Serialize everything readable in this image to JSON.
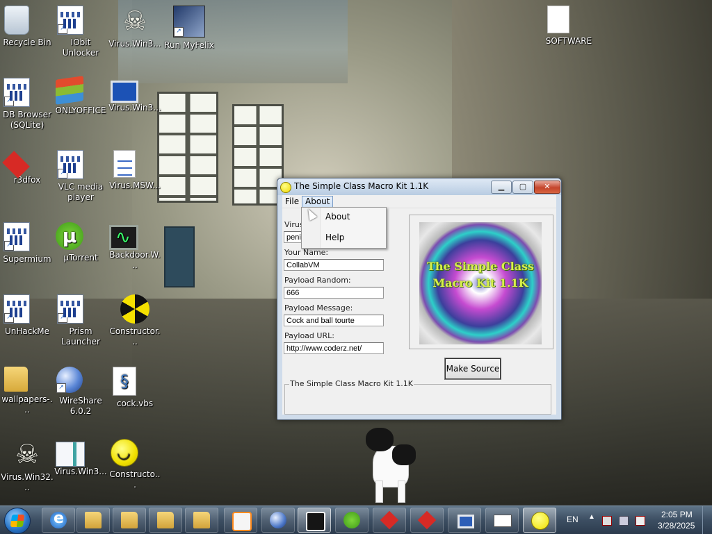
{
  "desktop": {
    "icons": [
      {
        "label": "Recycle Bin",
        "icon": "recycle-bin-icon"
      },
      {
        "label": "IObit Unlocker",
        "icon": "app-icon"
      },
      {
        "label": "Virus.Win3...",
        "icon": "skull-icon"
      },
      {
        "label": "Run MyFelix",
        "icon": "felix-icon"
      },
      {
        "label": "SOFTWARE",
        "icon": "file-icon"
      },
      {
        "label": "DB Browser (SQLite)",
        "icon": "app-icon"
      },
      {
        "label": "ONLYOFFICE",
        "icon": "onlyoffice-icon"
      },
      {
        "label": "Virus.Win3...",
        "icon": "computer-icon"
      },
      {
        "label": "r3dfox",
        "icon": "r3dfox-icon"
      },
      {
        "label": "VLC media player",
        "icon": "app-icon"
      },
      {
        "label": "Virus.MSW...",
        "icon": "document-icon"
      },
      {
        "label": "Supermium",
        "icon": "app-icon"
      },
      {
        "label": "µTorrent",
        "icon": "utorrent-icon"
      },
      {
        "label": "Backdoor.W...",
        "icon": "oscilloscope-icon"
      },
      {
        "label": "UnHackMe",
        "icon": "app-icon"
      },
      {
        "label": "Prism Launcher",
        "icon": "app-icon"
      },
      {
        "label": "Constructor...",
        "icon": "radiation-icon"
      },
      {
        "label": "wallpapers-...",
        "icon": "folder-icon"
      },
      {
        "label": "WireShare 6.0.2",
        "icon": "globe-icon"
      },
      {
        "label": "cock.vbs",
        "icon": "script-icon"
      },
      {
        "label": "Virus.Win32...",
        "icon": "skull-icon"
      },
      {
        "label": "Virus.Win3...",
        "icon": "webpage-icon"
      },
      {
        "label": "Constructo...",
        "icon": "smiley-icon"
      }
    ]
  },
  "window": {
    "title": "The Simple Class Macro Kit 1.1K",
    "controls": {
      "minimize": "▁",
      "maximize": "▢",
      "close": "✕"
    },
    "menu": {
      "file": "File",
      "about": "About"
    },
    "dropdown": {
      "items": [
        "About",
        "Help"
      ]
    },
    "form": {
      "virus_label": "Virus",
      "virus_value": "peni",
      "name_label": "Your Name:",
      "name_value": "CollabVM",
      "payload_random_label": "Payload Random:",
      "payload_random_value": "666",
      "payload_message_label": "Payload Message:",
      "payload_message_value": "Cock and ball tourte",
      "payload_url_label": "Payload URL:",
      "payload_url_value": "http://www.coderz.net/"
    },
    "picture_text": "The Simple Class Macro Kit 1.1K",
    "make_source_label": "Make Source",
    "groupbox_title": "The Simple Class Macro Kit 1.1K"
  },
  "taskbar": {
    "tasks": [
      "ie-icon",
      "folder-icon",
      "folder-icon",
      "folder-icon",
      "folder-download-icon",
      "media-player-icon",
      "globe-icon",
      "cat-icon",
      "utorrent-icon",
      "r3dfox-icon",
      "r3dfox-icon",
      "computer-icon",
      "mail-icon",
      "smiley-icon"
    ],
    "language": "EN",
    "time": "2:05 PM",
    "date": "3/28/2025"
  }
}
